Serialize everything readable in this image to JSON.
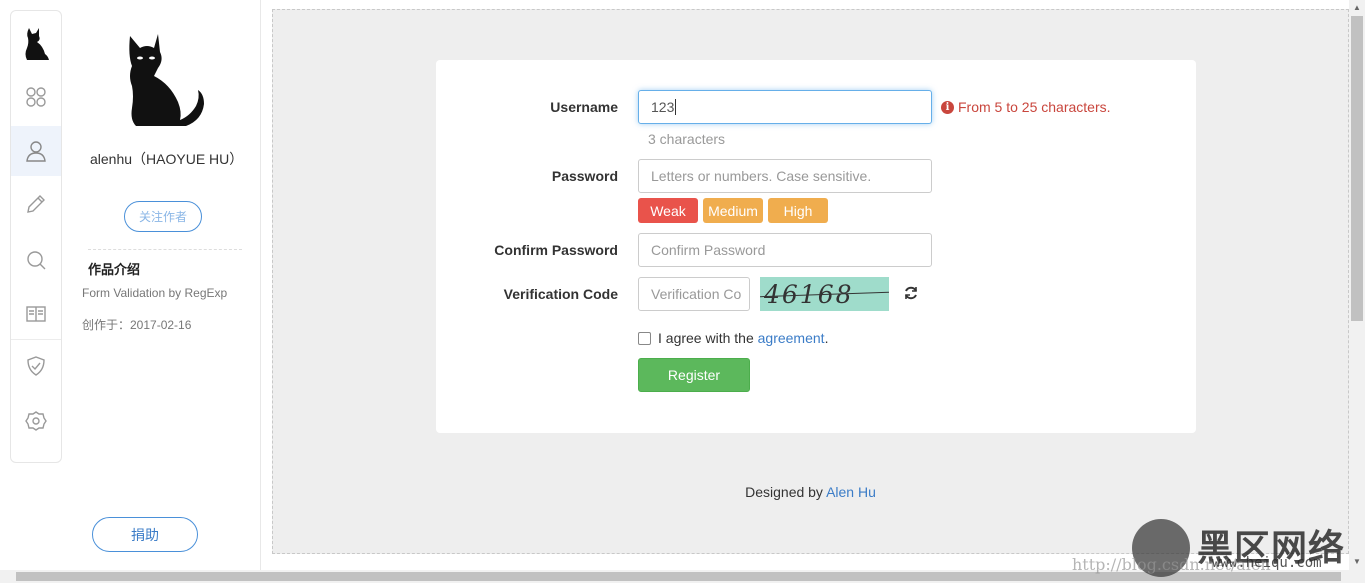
{
  "author": {
    "name": "alenhu（HAOYUE HU）",
    "follow_label": "关注作者",
    "intro_title": "作品介绍",
    "intro_desc": "Form Validation by RegExp",
    "created": "创作于：2017-02-16",
    "donate_label": "捐助"
  },
  "rail": {
    "icons": [
      "cat-logo-icon",
      "apps-icon",
      "user-icon",
      "pencil-icon",
      "search-icon",
      "book-icon",
      "shield-icon",
      "settings-icon"
    ]
  },
  "form": {
    "username": {
      "label": "Username",
      "value": "123",
      "error": "From 5 to 25 characters.",
      "hint": "3 characters"
    },
    "password": {
      "label": "Password",
      "placeholder": "Letters or numbers. Case sensitive."
    },
    "strength": {
      "weak": "Weak",
      "medium": "Medium",
      "high": "High",
      "weak_color": "#e9534b",
      "medium_color": "#f0ad4e",
      "high_color": "#f0ad4e"
    },
    "confirm": {
      "label": "Confirm Password",
      "placeholder": "Confirm Password"
    },
    "verification": {
      "label": "Verification Code",
      "placeholder": "Verification Co",
      "captcha": "46168"
    },
    "agree_prefix": "I agree with the ",
    "agree_link": "agreement",
    "agree_suffix": ".",
    "register_label": "Register"
  },
  "footer": {
    "prefix": "Designed by ",
    "author": "Alen Hu"
  },
  "watermark": {
    "cn": "黑区网络",
    "url_faint": "http://blog.csdn.net/alen",
    "url": "www.heiqu.com"
  },
  "colors": {
    "accent": "#3b7cc7",
    "success": "#5cb85c",
    "error": "#c9463d",
    "background": "#eeeeee"
  }
}
